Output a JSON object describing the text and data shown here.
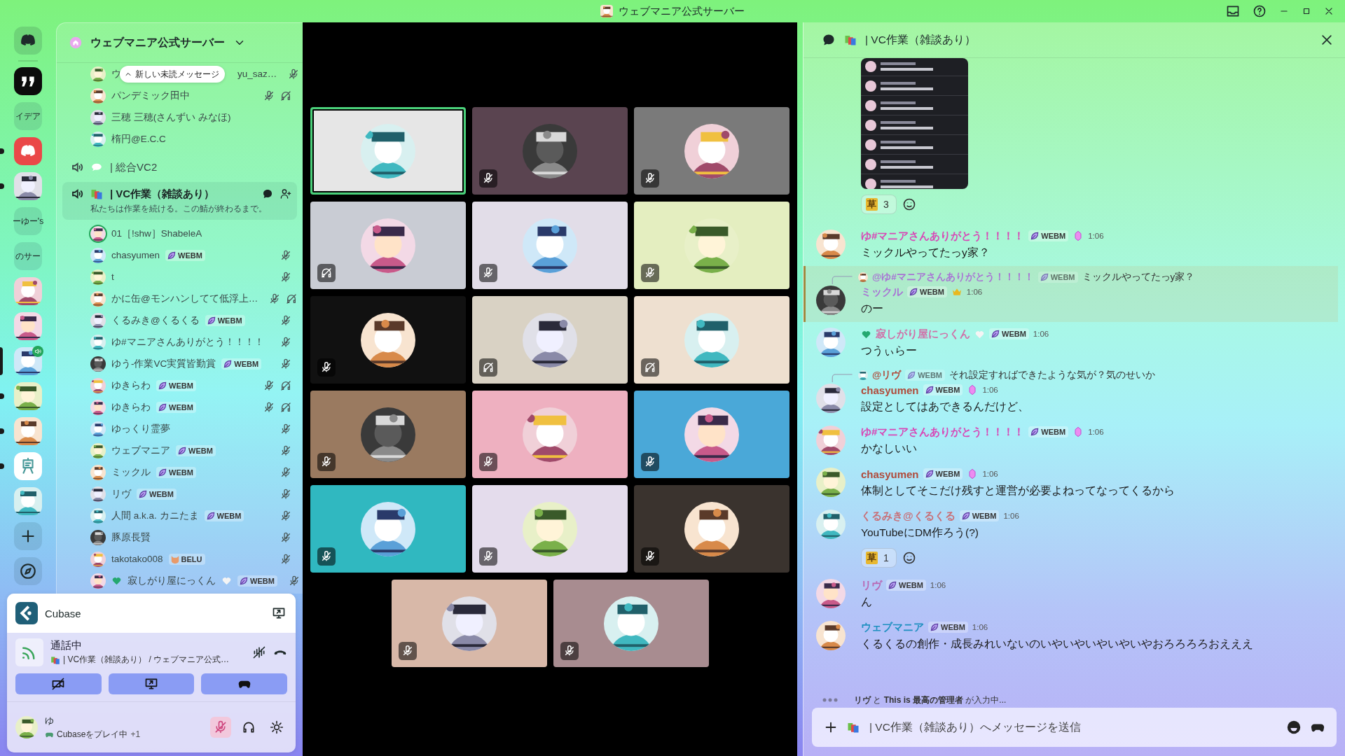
{
  "window": {
    "title": "ウェブマニア公式サーバー"
  },
  "server_rail": [
    {
      "kind": "logo",
      "unread": false,
      "selected": false
    },
    {
      "kind": "quote",
      "unread": false,
      "selected": false
    },
    {
      "kind": "text",
      "label": "イデア",
      "unread": false,
      "selected": false
    },
    {
      "kind": "logo_red",
      "unread": true,
      "selected": false
    },
    {
      "kind": "picture",
      "unread": true,
      "selected": false
    },
    {
      "kind": "text",
      "label": "ーゆー's",
      "unread": false,
      "selected": false
    },
    {
      "kind": "text",
      "label": "のサー",
      "unread": false,
      "selected": false
    },
    {
      "kind": "picture",
      "unread": false,
      "selected": false
    },
    {
      "kind": "picture",
      "unread": false,
      "selected": false
    },
    {
      "kind": "picture",
      "unread": false,
      "selected": true,
      "speaking": true
    },
    {
      "kind": "picture",
      "unread": true,
      "selected": false
    },
    {
      "kind": "picture",
      "unread": true,
      "selected": false
    },
    {
      "kind": "easel",
      "unread": true,
      "selected": false
    },
    {
      "kind": "picture",
      "unread": false,
      "selected": false
    },
    {
      "kind": "add",
      "unread": false,
      "selected": false
    },
    {
      "kind": "discover",
      "unread": false,
      "selected": false
    }
  ],
  "channel_panel": {
    "server_name": "ウェブマニア公式サーバー",
    "unread_pill": "新しい未読メッセージ"
  },
  "channel_list": [
    {
      "kind": "user",
      "name": "ウ",
      "name_end": "yu_saz…",
      "muted": true,
      "deafened": false,
      "speaking": false
    },
    {
      "kind": "user",
      "name": "パンデミック田中",
      "muted": true,
      "deafened": true,
      "speaking": false
    },
    {
      "kind": "user",
      "name": "三穂 三穂(さんずい みなほ)",
      "muted": false,
      "deafened": false,
      "speaking": false
    },
    {
      "kind": "user",
      "name": "楕円@E.C.C",
      "muted": false,
      "deafened": false,
      "speaking": false
    },
    {
      "kind": "voice_channel",
      "emoji": {
        "kind": "speech"
      },
      "name": "| 総合VC2",
      "selected": false
    },
    {
      "kind": "voice_channel",
      "emoji": {
        "kind": "books"
      },
      "name": "| VC作業（雑談あり）",
      "description": "私たちは作業を続ける。この鯖が終わるまで。",
      "selected": true
    },
    {
      "kind": "user",
      "name": "01［!shw］ShabeleA",
      "muted": false,
      "deafened": false,
      "speaking": true
    },
    {
      "kind": "user",
      "name": "chasyumen",
      "badge": {
        "kind": "leaf",
        "text": "WEBM"
      },
      "muted": true,
      "deafened": false,
      "speaking": false
    },
    {
      "kind": "user",
      "name": "t",
      "muted": true,
      "deafened": false,
      "speaking": false
    },
    {
      "kind": "user",
      "name": "かに缶@モンハンしてて低浮上…",
      "muted": true,
      "deafened": true,
      "speaking": false
    },
    {
      "kind": "user",
      "name": "くるみき@くるくる",
      "badge": {
        "kind": "leaf",
        "text": "WEBM"
      },
      "muted": true,
      "deafened": false,
      "speaking": false
    },
    {
      "kind": "user",
      "name": "ゆ#マニアさんありがとう！！！！",
      "muted": true,
      "deafened": false,
      "speaking": false
    },
    {
      "kind": "user",
      "name": "ゆう-作業VC実質皆勤賞",
      "badge": {
        "kind": "leaf",
        "text": "WEBM"
      },
      "muted": true,
      "deafened": false,
      "speaking": false
    },
    {
      "kind": "user",
      "name": "ゆきらわ",
      "badge": {
        "kind": "leaf",
        "text": "WEBM"
      },
      "muted": true,
      "deafened": true,
      "speaking": false
    },
    {
      "kind": "user",
      "name": "ゆきらわ",
      "badge": {
        "kind": "leaf",
        "text": "WEBM"
      },
      "muted": true,
      "deafened": true,
      "speaking": false
    },
    {
      "kind": "user",
      "name": "ゆっくり霊夢",
      "muted": true,
      "deafened": false,
      "speaking": false
    },
    {
      "kind": "user",
      "name": "ウェブマニア",
      "badge": {
        "kind": "leaf",
        "text": "WEBM"
      },
      "muted": true,
      "deafened": false,
      "speaking": false
    },
    {
      "kind": "user",
      "name": "ミックル",
      "badge": {
        "kind": "leaf",
        "text": "WEBM"
      },
      "muted": true,
      "deafened": false,
      "speaking": false
    },
    {
      "kind": "user",
      "name": "リヴ",
      "badge": {
        "kind": "leaf",
        "text": "WEBM"
      },
      "muted": true,
      "deafened": false,
      "speaking": false
    },
    {
      "kind": "user",
      "name": "人間 a.k.a. カニたま",
      "badge": {
        "kind": "leaf",
        "text": "WEBM"
      },
      "muted": true,
      "deafened": false,
      "speaking": false
    },
    {
      "kind": "user",
      "name": "豚原長賢",
      "muted": true,
      "deafened": false,
      "speaking": false
    },
    {
      "kind": "user",
      "name": "takotako008",
      "badge": {
        "kind": "cat",
        "text": "BELU"
      },
      "muted": true,
      "deafened": false,
      "speaking": false
    },
    {
      "kind": "user",
      "name": "寂しがり屋にっくん",
      "hearts": true,
      "badge": {
        "kind": "leaf",
        "text": "WEBM"
      },
      "muted": true,
      "deafened": false,
      "speaking": false
    }
  ],
  "activity": {
    "name": "Cubase"
  },
  "voice_status": {
    "status": "通話中",
    "channel": "| VC作業（雑談あり） / ウェブマニア公式…"
  },
  "user_panel": {
    "name": "ゆ",
    "activity": "Cubaseをプレイ中",
    "extra": "+1",
    "mic_muted": true
  },
  "video_tiles": [
    {
      "color": "#e6e6e6",
      "kind": "none",
      "speaking": true
    },
    {
      "color": "#5a4450",
      "kind": "muted",
      "speaking": false
    },
    {
      "color": "#7a7a7a",
      "kind": "muted",
      "speaking": false
    },
    {
      "color": "#c9ccd4",
      "kind": "deafened",
      "speaking": false
    },
    {
      "color": "#e2dde8",
      "kind": "muted",
      "speaking": false
    },
    {
      "color": "#e4eec0",
      "kind": "muted",
      "speaking": false
    },
    {
      "color": "#111111",
      "kind": "muted",
      "speaking": false
    },
    {
      "color": "#d9d2c4",
      "kind": "deafened",
      "speaking": false
    },
    {
      "color": "#eee0d0",
      "kind": "deafened",
      "speaking": false
    },
    {
      "color": "#9a7a60",
      "kind": "muted",
      "speaking": false
    },
    {
      "color": "#eeb0c0",
      "kind": "muted",
      "speaking": false
    },
    {
      "color": "#4aa8d8",
      "kind": "muted",
      "speaking": false
    },
    {
      "color": "#30b8c0",
      "kind": "muted",
      "speaking": false
    },
    {
      "color": "#e4dcec",
      "kind": "muted",
      "speaking": false
    },
    {
      "color": "#3a332e",
      "kind": "muted",
      "speaking": false
    },
    {
      "color": "#d8b8a8",
      "kind": "muted",
      "speaking": false
    },
    {
      "color": "#a88c90",
      "kind": "muted",
      "speaking": false
    }
  ],
  "chat": {
    "title": "| VC作業（雑談あり）",
    "messages": [
      {
        "kind": "attachment",
        "reactions": [
          {
            "emoji": "草",
            "count": "3"
          }
        ]
      },
      {
        "kind": "message",
        "author": "ゆ#マニアさんありがとう！！！！",
        "color": "#d848b6",
        "badge": "WEBM",
        "gem": true,
        "crown": false,
        "time": "1:06",
        "text": "ミックルやってたっy家？",
        "highlighted": false
      },
      {
        "kind": "message",
        "reply": {
          "author": "@ゆ#マニアさんありがとう！！！！",
          "badge": "WEBM",
          "text": "ミックルやってたっy家？"
        },
        "author": "ミックル",
        "color": "#a874d4",
        "badge": "WEBM",
        "gem": false,
        "crown": true,
        "time": "1:06",
        "text": "のー",
        "highlighted": true
      },
      {
        "kind": "message",
        "author": "寂しがり屋にっくん",
        "hearts": true,
        "color": "#d070a8",
        "badge": "WEBM",
        "gem": false,
        "crown": false,
        "time": "1:06",
        "text": "つうぃらー",
        "highlighted": false
      },
      {
        "kind": "message",
        "reply": {
          "author": "@リヴ",
          "badge": "WEBM",
          "text": "それ設定すればできたような気が？気のせいか"
        },
        "author": "chasyumen",
        "color": "#b04a3a",
        "badge": "WEBM",
        "gem": true,
        "crown": false,
        "time": "1:06",
        "text": "設定としてはあできるんだけど、",
        "highlighted": false
      },
      {
        "kind": "message",
        "author": "ゆ#マニアさんありがとう！！！！",
        "color": "#d848b6",
        "badge": "WEBM",
        "gem": true,
        "crown": false,
        "time": "1:06",
        "text": "かなしいい",
        "highlighted": false
      },
      {
        "kind": "message",
        "author": "chasyumen",
        "color": "#b04a3a",
        "badge": "WEBM",
        "gem": true,
        "crown": false,
        "time": "1:06",
        "text": "体制としてそこだけ残すと運営が必要よねってなってくるから",
        "highlighted": false
      },
      {
        "kind": "message",
        "author": "くるみき@くるくる",
        "color": "#c87078",
        "badge": "WEBM",
        "gem": false,
        "crown": false,
        "time": "1:06",
        "text": "YouTubeにDM作ろう(?)",
        "highlighted": false,
        "reactions": [
          {
            "emoji": "草",
            "count": "1"
          }
        ]
      },
      {
        "kind": "message",
        "author": "リヴ",
        "color": "#b868b4",
        "badge": "WEBM",
        "gem": false,
        "crown": false,
        "time": "1:06",
        "text": "ん",
        "highlighted": false
      },
      {
        "kind": "message",
        "author": "ウェブマニア",
        "color": "#1f90c0",
        "badge": "WEBM",
        "gem": false,
        "crown": false,
        "time": "1:06",
        "text": "くるくるの創作・成長みれいないのいやいやいやいやいやおろろろろおえええ",
        "highlighted": false
      }
    ],
    "typing": "**リヴ** と **This is 最高の管理者** が入力中...",
    "input_placeholder": "| VC作業（雑談あり）へメッセージを送信"
  }
}
